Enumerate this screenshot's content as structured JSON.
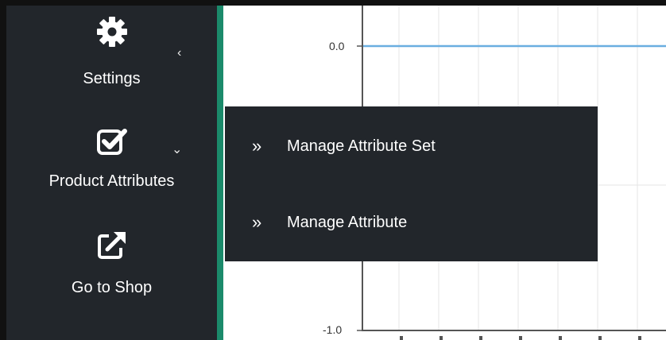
{
  "sidebar": {
    "items": [
      {
        "label": "Settings",
        "icon": "gear-icon",
        "caret": "‹"
      },
      {
        "label": "Product Attributes",
        "icon": "checkbox-icon",
        "caret": "⌄"
      },
      {
        "label": "Go to Shop",
        "icon": "external-link-icon"
      }
    ]
  },
  "dropdown": {
    "items": [
      {
        "label": "Manage Attribute Set",
        "icon": "double-chevron-right-icon",
        "glyph": "»"
      },
      {
        "label": "Manage Attribute",
        "icon": "double-chevron-right-icon",
        "glyph": "»"
      }
    ]
  },
  "chart": {
    "ticks": [
      "0.0",
      "-1.0"
    ]
  },
  "colors": {
    "sidebar_bg": "#22262b",
    "accent": "#1b8a6b",
    "series_line": "#6aaee0"
  }
}
